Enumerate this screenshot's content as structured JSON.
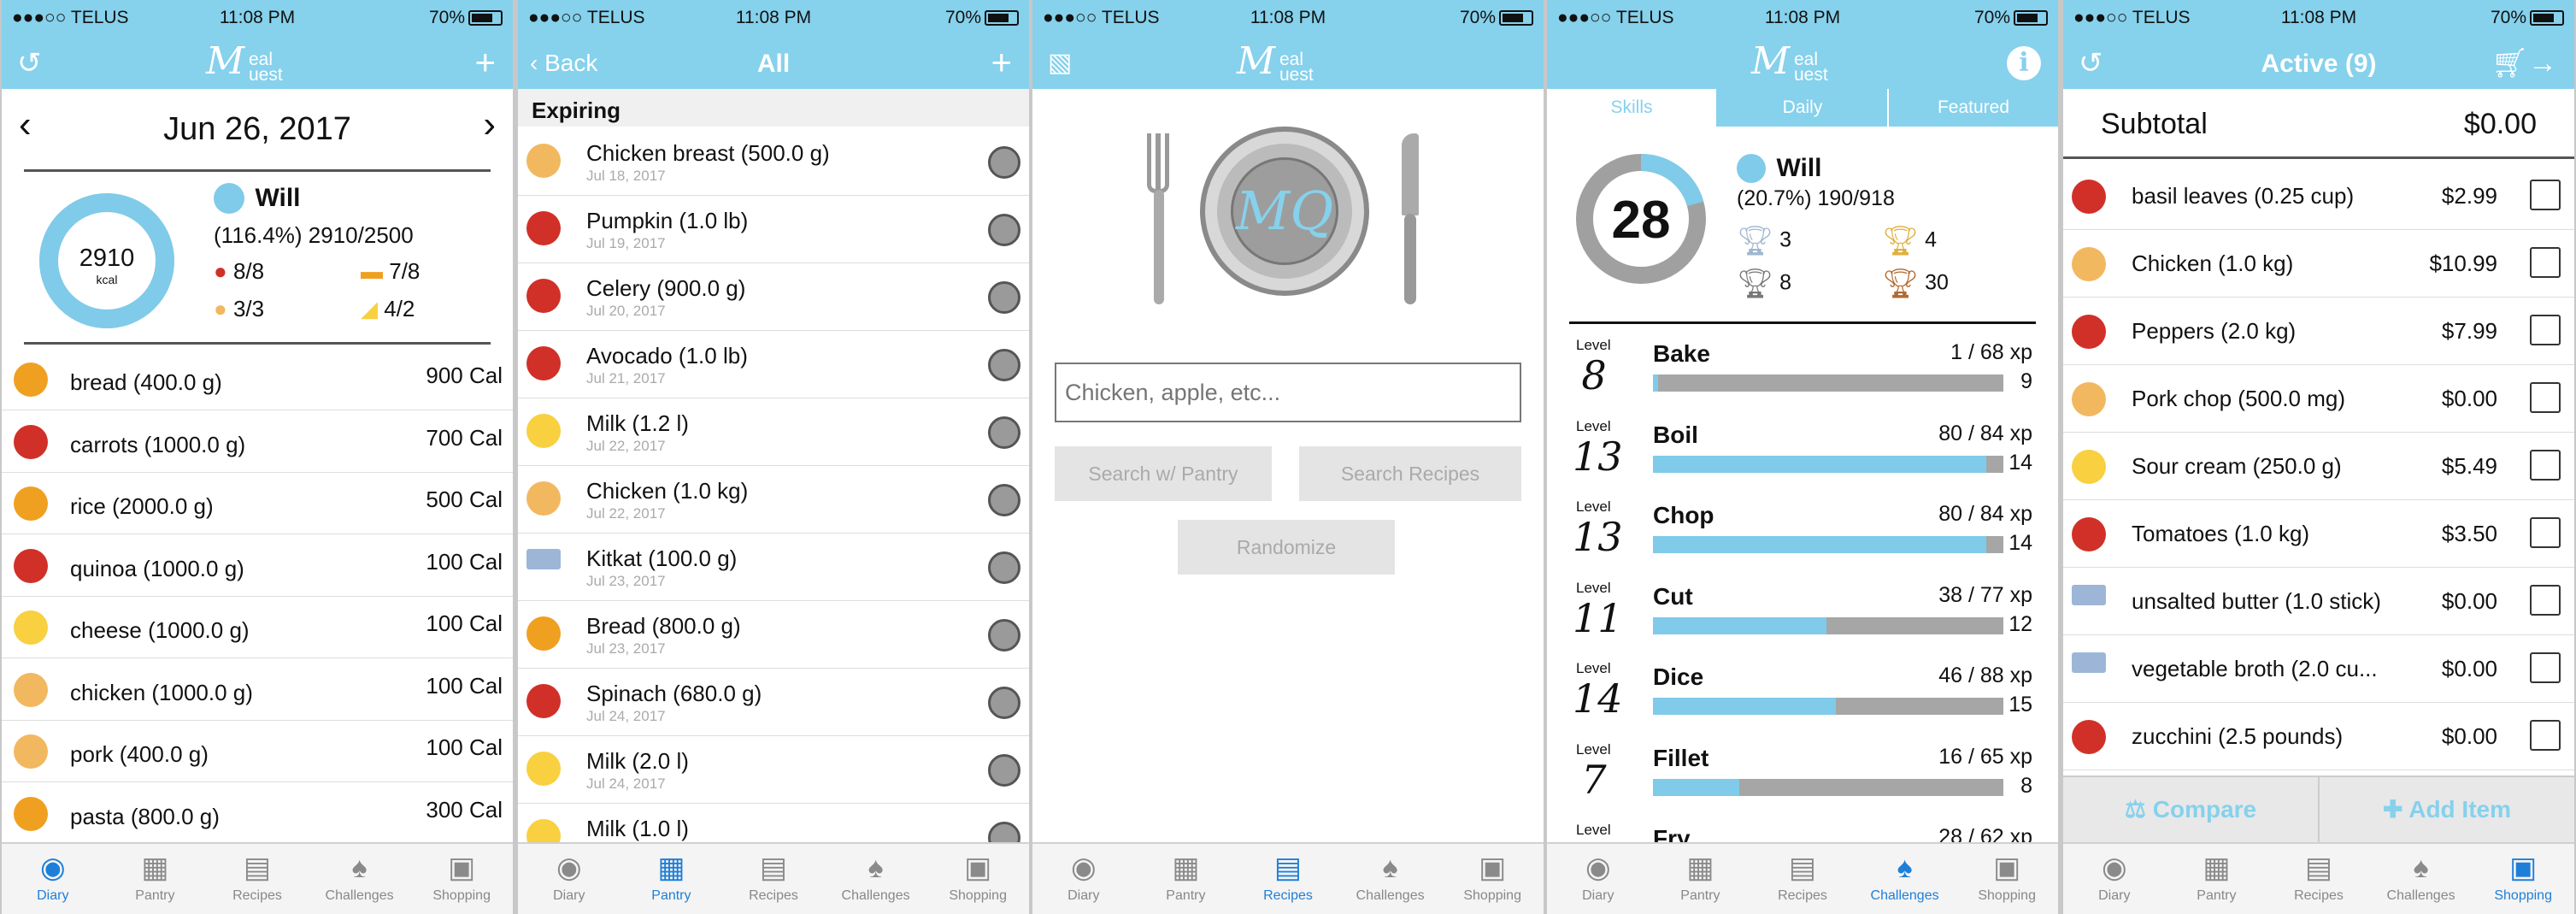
{
  "status": {
    "carrier": "●●●○○ TELUS",
    "wifi": "wifi-icon",
    "time": "11:08 PM",
    "battery": "70%"
  },
  "tabs": [
    {
      "label": "Diary",
      "icon": "person-icon"
    },
    {
      "label": "Pantry",
      "icon": "pantry-icon"
    },
    {
      "label": "Recipes",
      "icon": "book-icon"
    },
    {
      "label": "Challenges",
      "icon": "trophy-icon"
    },
    {
      "label": "Shopping",
      "icon": "cart-icon"
    }
  ],
  "logo": {
    "m": "M",
    "t1": "eal",
    "t2": "uest"
  },
  "diary": {
    "date": "Jun 26, 2017",
    "calories": "2910",
    "calories_unit": "kcal",
    "calories_fraction": 1.0,
    "user": "Will",
    "summary": "(116.4%) 2910/2500",
    "groups": [
      {
        "icon": "vegetable-icon",
        "value": "8/8"
      },
      {
        "icon": "bread-icon",
        "value": "7/8"
      },
      {
        "icon": "meat-icon",
        "value": "3/3"
      },
      {
        "icon": "cheese-icon",
        "value": "4/2"
      }
    ],
    "items": [
      {
        "icon": "bread-icon",
        "name": "bread (400.0 g)",
        "cal": "900 Cal"
      },
      {
        "icon": "vegetable-icon",
        "name": "carrots (1000.0 g)",
        "cal": "700 Cal"
      },
      {
        "icon": "bread-icon",
        "name": "rice (2000.0 g)",
        "cal": "500 Cal"
      },
      {
        "icon": "vegetable-icon",
        "name": "quinoa (1000.0 g)",
        "cal": "100 Cal"
      },
      {
        "icon": "cheese-icon",
        "name": "cheese (1000.0 g)",
        "cal": "100 Cal"
      },
      {
        "icon": "meat-icon",
        "name": "chicken (1000.0 g)",
        "cal": "100 Cal"
      },
      {
        "icon": "meat-icon",
        "name": "pork (400.0 g)",
        "cal": "100 Cal"
      },
      {
        "icon": "bread-icon",
        "name": "pasta (800.0 g)",
        "cal": "300 Cal"
      }
    ]
  },
  "pantry": {
    "back": "Back",
    "title": "All",
    "section": "Expiring",
    "items": [
      {
        "icon": "meat-icon",
        "name": "Chicken breast (500.0 g)",
        "date": "Jul 18, 2017"
      },
      {
        "icon": "vegetable-icon",
        "name": "Pumpkin (1.0 lb)",
        "date": "Jul 19, 2017"
      },
      {
        "icon": "vegetable-icon",
        "name": "Celery (900.0 g)",
        "date": "Jul 20, 2017"
      },
      {
        "icon": "vegetable-icon",
        "name": "Avocado (1.0 lb)",
        "date": "Jul 21, 2017"
      },
      {
        "icon": "cheese-icon",
        "name": "Milk (1.2 l)",
        "date": "Jul 22, 2017"
      },
      {
        "icon": "meat-icon",
        "name": "Chicken (1.0 kg)",
        "date": "Jul 22, 2017"
      },
      {
        "icon": "barcode-icon",
        "name": "Kitkat (100.0 g)",
        "date": "Jul 23, 2017"
      },
      {
        "icon": "bread-icon",
        "name": "Bread (800.0 g)",
        "date": "Jul 23, 2017"
      },
      {
        "icon": "vegetable-icon",
        "name": "Spinach (680.0 g)",
        "date": "Jul 24, 2017"
      },
      {
        "icon": "cheese-icon",
        "name": "Milk (2.0 l)",
        "date": "Jul 24, 2017"
      },
      {
        "icon": "cheese-icon",
        "name": "Milk (1.0 l)",
        "date": ""
      }
    ]
  },
  "recipes": {
    "logo_text": "MQ",
    "search_placeholder": "Chicken, apple, etc...",
    "btn_pantry": "Search w/ Pantry",
    "btn_search": "Search Recipes",
    "btn_random": "Randomize"
  },
  "challenges": {
    "tabs": [
      "Skills",
      "Daily",
      "Featured"
    ],
    "level": "28",
    "level_fraction": 0.207,
    "user": "Will",
    "summary": "(20.7%) 190/918",
    "trophies": [
      {
        "icon": "silver-trophy-icon",
        "count": "3"
      },
      {
        "icon": "gold-trophy-icon",
        "count": "4"
      },
      {
        "icon": "grey-trophy-icon",
        "count": "8"
      },
      {
        "icon": "bronze-trophy-icon",
        "count": "30"
      }
    ],
    "level_label": "Level",
    "skills": [
      {
        "level": "8",
        "name": "Bake",
        "xp": "1 / 68 xp",
        "next": "9",
        "fraction": 0.015
      },
      {
        "level": "13",
        "name": "Boil",
        "xp": "80 / 84 xp",
        "next": "14",
        "fraction": 0.952
      },
      {
        "level": "13",
        "name": "Chop",
        "xp": "80 / 84 xp",
        "next": "14",
        "fraction": 0.952
      },
      {
        "level": "11",
        "name": "Cut",
        "xp": "38 / 77 xp",
        "next": "12",
        "fraction": 0.494
      },
      {
        "level": "14",
        "name": "Dice",
        "xp": "46 / 88 xp",
        "next": "15",
        "fraction": 0.523
      },
      {
        "level": "7",
        "name": "Fillet",
        "xp": "16 / 65 xp",
        "next": "8",
        "fraction": 0.246
      },
      {
        "level": "",
        "name": "Fry",
        "xp": "28 / 62 xp",
        "next": "",
        "fraction": 0.45
      }
    ]
  },
  "shopping": {
    "title": "Active (9)",
    "subtotal_label": "Subtotal",
    "subtotal": "$0.00",
    "items": [
      {
        "icon": "vegetable-icon",
        "name": "basil leaves (0.25 cup)",
        "price": "$2.99"
      },
      {
        "icon": "meat-icon",
        "name": "Chicken (1.0 kg)",
        "price": "$10.99"
      },
      {
        "icon": "vegetable-icon",
        "name": "Peppers (2.0 kg)",
        "price": "$7.99"
      },
      {
        "icon": "meat-icon",
        "name": "Pork chop (500.0 mg)",
        "price": "$0.00"
      },
      {
        "icon": "cheese-icon",
        "name": "Sour cream (250.0 g)",
        "price": "$5.49"
      },
      {
        "icon": "vegetable-icon",
        "name": "Tomatoes (1.0 kg)",
        "price": "$3.50"
      },
      {
        "icon": "barcode-icon",
        "name": "unsalted butter (1.0 stick)",
        "price": "$0.00"
      },
      {
        "icon": "barcode-icon",
        "name": "vegetable broth (2.0 cu...",
        "price": "$0.00"
      },
      {
        "icon": "vegetable-icon",
        "name": "zucchini (2.5 pounds)",
        "price": "$0.00"
      }
    ],
    "compare": "Compare",
    "add_item": "Add Item"
  }
}
